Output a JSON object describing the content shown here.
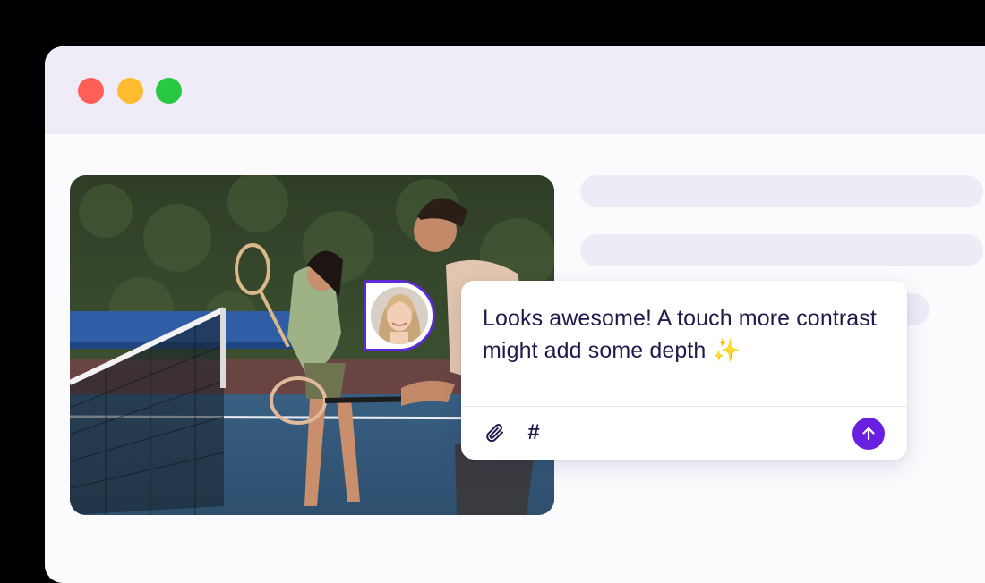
{
  "window": {
    "controls": [
      {
        "name": "close",
        "color": "#ff5f57"
      },
      {
        "name": "minimize",
        "color": "#febc2e"
      },
      {
        "name": "maximize",
        "color": "#28c840"
      }
    ]
  },
  "comment": {
    "text": "Looks awesome! A touch more contrast might add some depth",
    "emoji": "✨",
    "hashtag_glyph": "#",
    "attach_icon": "paperclip-icon",
    "send_icon": "arrow-up-icon"
  },
  "colors": {
    "accent": "#6a1fe0",
    "text": "#1f1b4d",
    "skeleton": "#eeebf7",
    "titlebar": "#efecf8"
  }
}
